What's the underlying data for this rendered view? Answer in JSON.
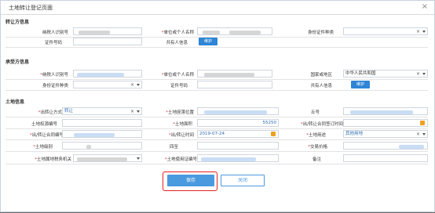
{
  "window": {
    "title": "土地转让登记页面",
    "close": "×"
  },
  "transferor": {
    "section": "转让方信息",
    "taxpayer_id_label": "纳税人识别号",
    "unit_name_label": "单位或个人名称",
    "id_type_label": "身份证件种类",
    "id_number_label": "证件号码",
    "co_owner_label": "共有人信息",
    "maintain_button": "维护"
  },
  "transferee": {
    "section": "承受方信息",
    "taxpayer_id_label": "纳税人识别号",
    "unit_name_label": "单位或个人名称",
    "country_label": "国家或地区",
    "country_value": "中华人民共和国",
    "id_type_label": "身份证件种类",
    "id_number_label": "证件号码",
    "co_owner_label": "共有人信息",
    "maintain_button": "维护"
  },
  "land": {
    "section": "土地信息",
    "transfer_method_label": "出转让方式",
    "transfer_method_value": "转让",
    "location_label": "土地座落位置",
    "lot_number_label": "丘号",
    "cert_number_label": "土地权源编号",
    "area_label": "土地面积",
    "area_value": "55250",
    "contract_sign_time_label": "出/转让合同签订时间",
    "contract_number_label": "出/转让合同编号",
    "transfer_time_label": "出/转让时间",
    "transfer_time_value": "2019-07-24",
    "land_use_label": "土地用途",
    "land_use_value": "其他用地",
    "land_grade_label": "土地级别",
    "boundary_label": "四至",
    "price_label": "交易价格",
    "tax_authority_label": "土地属地税务机关",
    "usage_cert_label": "土地使用证编号",
    "remarks_label": "备注"
  },
  "actions": {
    "save": "保存",
    "cancel": "关闭"
  }
}
